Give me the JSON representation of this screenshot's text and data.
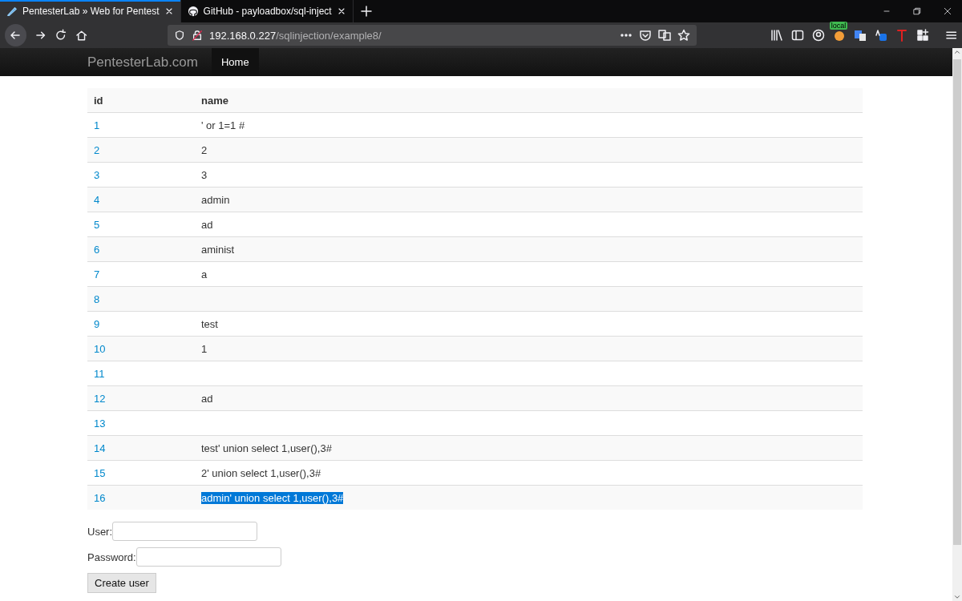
{
  "browser": {
    "tabs": [
      {
        "title": "PentesterLab » Web for Pentest",
        "selected": true
      },
      {
        "title": "GitHub - payloadbox/sql-inject",
        "selected": false
      }
    ],
    "url": {
      "host": "192.168.0.227",
      "path": "/sqlinjection/example8/"
    },
    "extension_badge": "local"
  },
  "navbar": {
    "brand": "PentesterLab.com",
    "items": [
      {
        "label": "Home",
        "selected": true
      }
    ]
  },
  "table": {
    "columns": [
      "id",
      "name"
    ],
    "rows": [
      {
        "id": "1",
        "name": "' or 1=1 #",
        "text_selected": false
      },
      {
        "id": "2",
        "name": "2",
        "text_selected": false
      },
      {
        "id": "3",
        "name": "3",
        "text_selected": false
      },
      {
        "id": "4",
        "name": "admin",
        "text_selected": false
      },
      {
        "id": "5",
        "name": "ad",
        "text_selected": false
      },
      {
        "id": "6",
        "name": "aminist",
        "text_selected": false
      },
      {
        "id": "7",
        "name": "a",
        "text_selected": false
      },
      {
        "id": "8"
      },
      {
        "id": "9",
        "name": "test",
        "text_selected": false
      },
      {
        "id": "10",
        "name": "1",
        "text_selected": false
      },
      {
        "id": "11"
      },
      {
        "id": "12",
        "name": "ad",
        "text_selected": false
      },
      {
        "id": "13"
      },
      {
        "id": "14",
        "name": "test' union select 1,user(),3#",
        "text_selected": false
      },
      {
        "id": "15",
        "name": "2' union select 1,user(),3#",
        "text_selected": false
      },
      {
        "id": "16",
        "name": "admin' union select 1,user(),3#",
        "text_selected": true
      }
    ]
  },
  "form": {
    "fields": [
      {
        "label": "User:"
      },
      {
        "label": "Password:"
      }
    ],
    "submit": "Create user"
  }
}
